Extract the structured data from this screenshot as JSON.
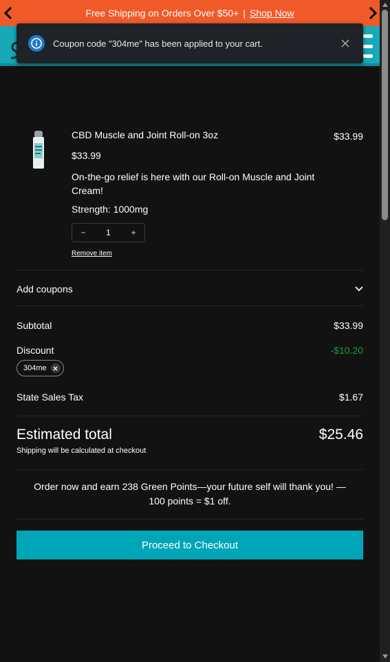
{
  "announcement": {
    "text": "Free Shipping on Orders Over $50+",
    "separator": "|",
    "link": "Shop Now",
    "bg_color": "#f05a28"
  },
  "header": {
    "bg_color": "#16a9b8"
  },
  "toast": {
    "message": "Coupon code \"304me\" has been applied to your cart.",
    "icon": "info-icon",
    "close_icon": "close-icon"
  },
  "cart_item": {
    "name": "CBD Muscle and Joint Roll-on 3oz",
    "line_price": "$33.99",
    "unit_price": "$33.99",
    "description": "On-the-go relief is here with our Roll-on Muscle and Joint Cream!",
    "strength": "Strength: 1000mg",
    "quantity": {
      "minus": "−",
      "value": "1",
      "plus": "+"
    },
    "remove_label": "Remove item"
  },
  "coupons": {
    "label": "Add coupons",
    "icon": "chevron-down-icon"
  },
  "summary": {
    "subtotal_label": "Subtotal",
    "subtotal_value": "$33.99",
    "discount_label": "Discount",
    "discount_value": "-$10.20",
    "discount_color": "#1a9b3a",
    "coupon_chip": "304me",
    "tax_label": "State Sales Tax",
    "tax_value": "$1.67",
    "estimated_label": "Estimated total",
    "estimated_value": "$25.46",
    "shipping_note": "Shipping will be calculated at checkout"
  },
  "points": {
    "line1": "Order now and earn 238 Green Points—your future self will thank you! —",
    "line2": "100 points = $1 off."
  },
  "checkout": {
    "label": "Proceed to Checkout",
    "bg_color": "#00a5b8"
  }
}
